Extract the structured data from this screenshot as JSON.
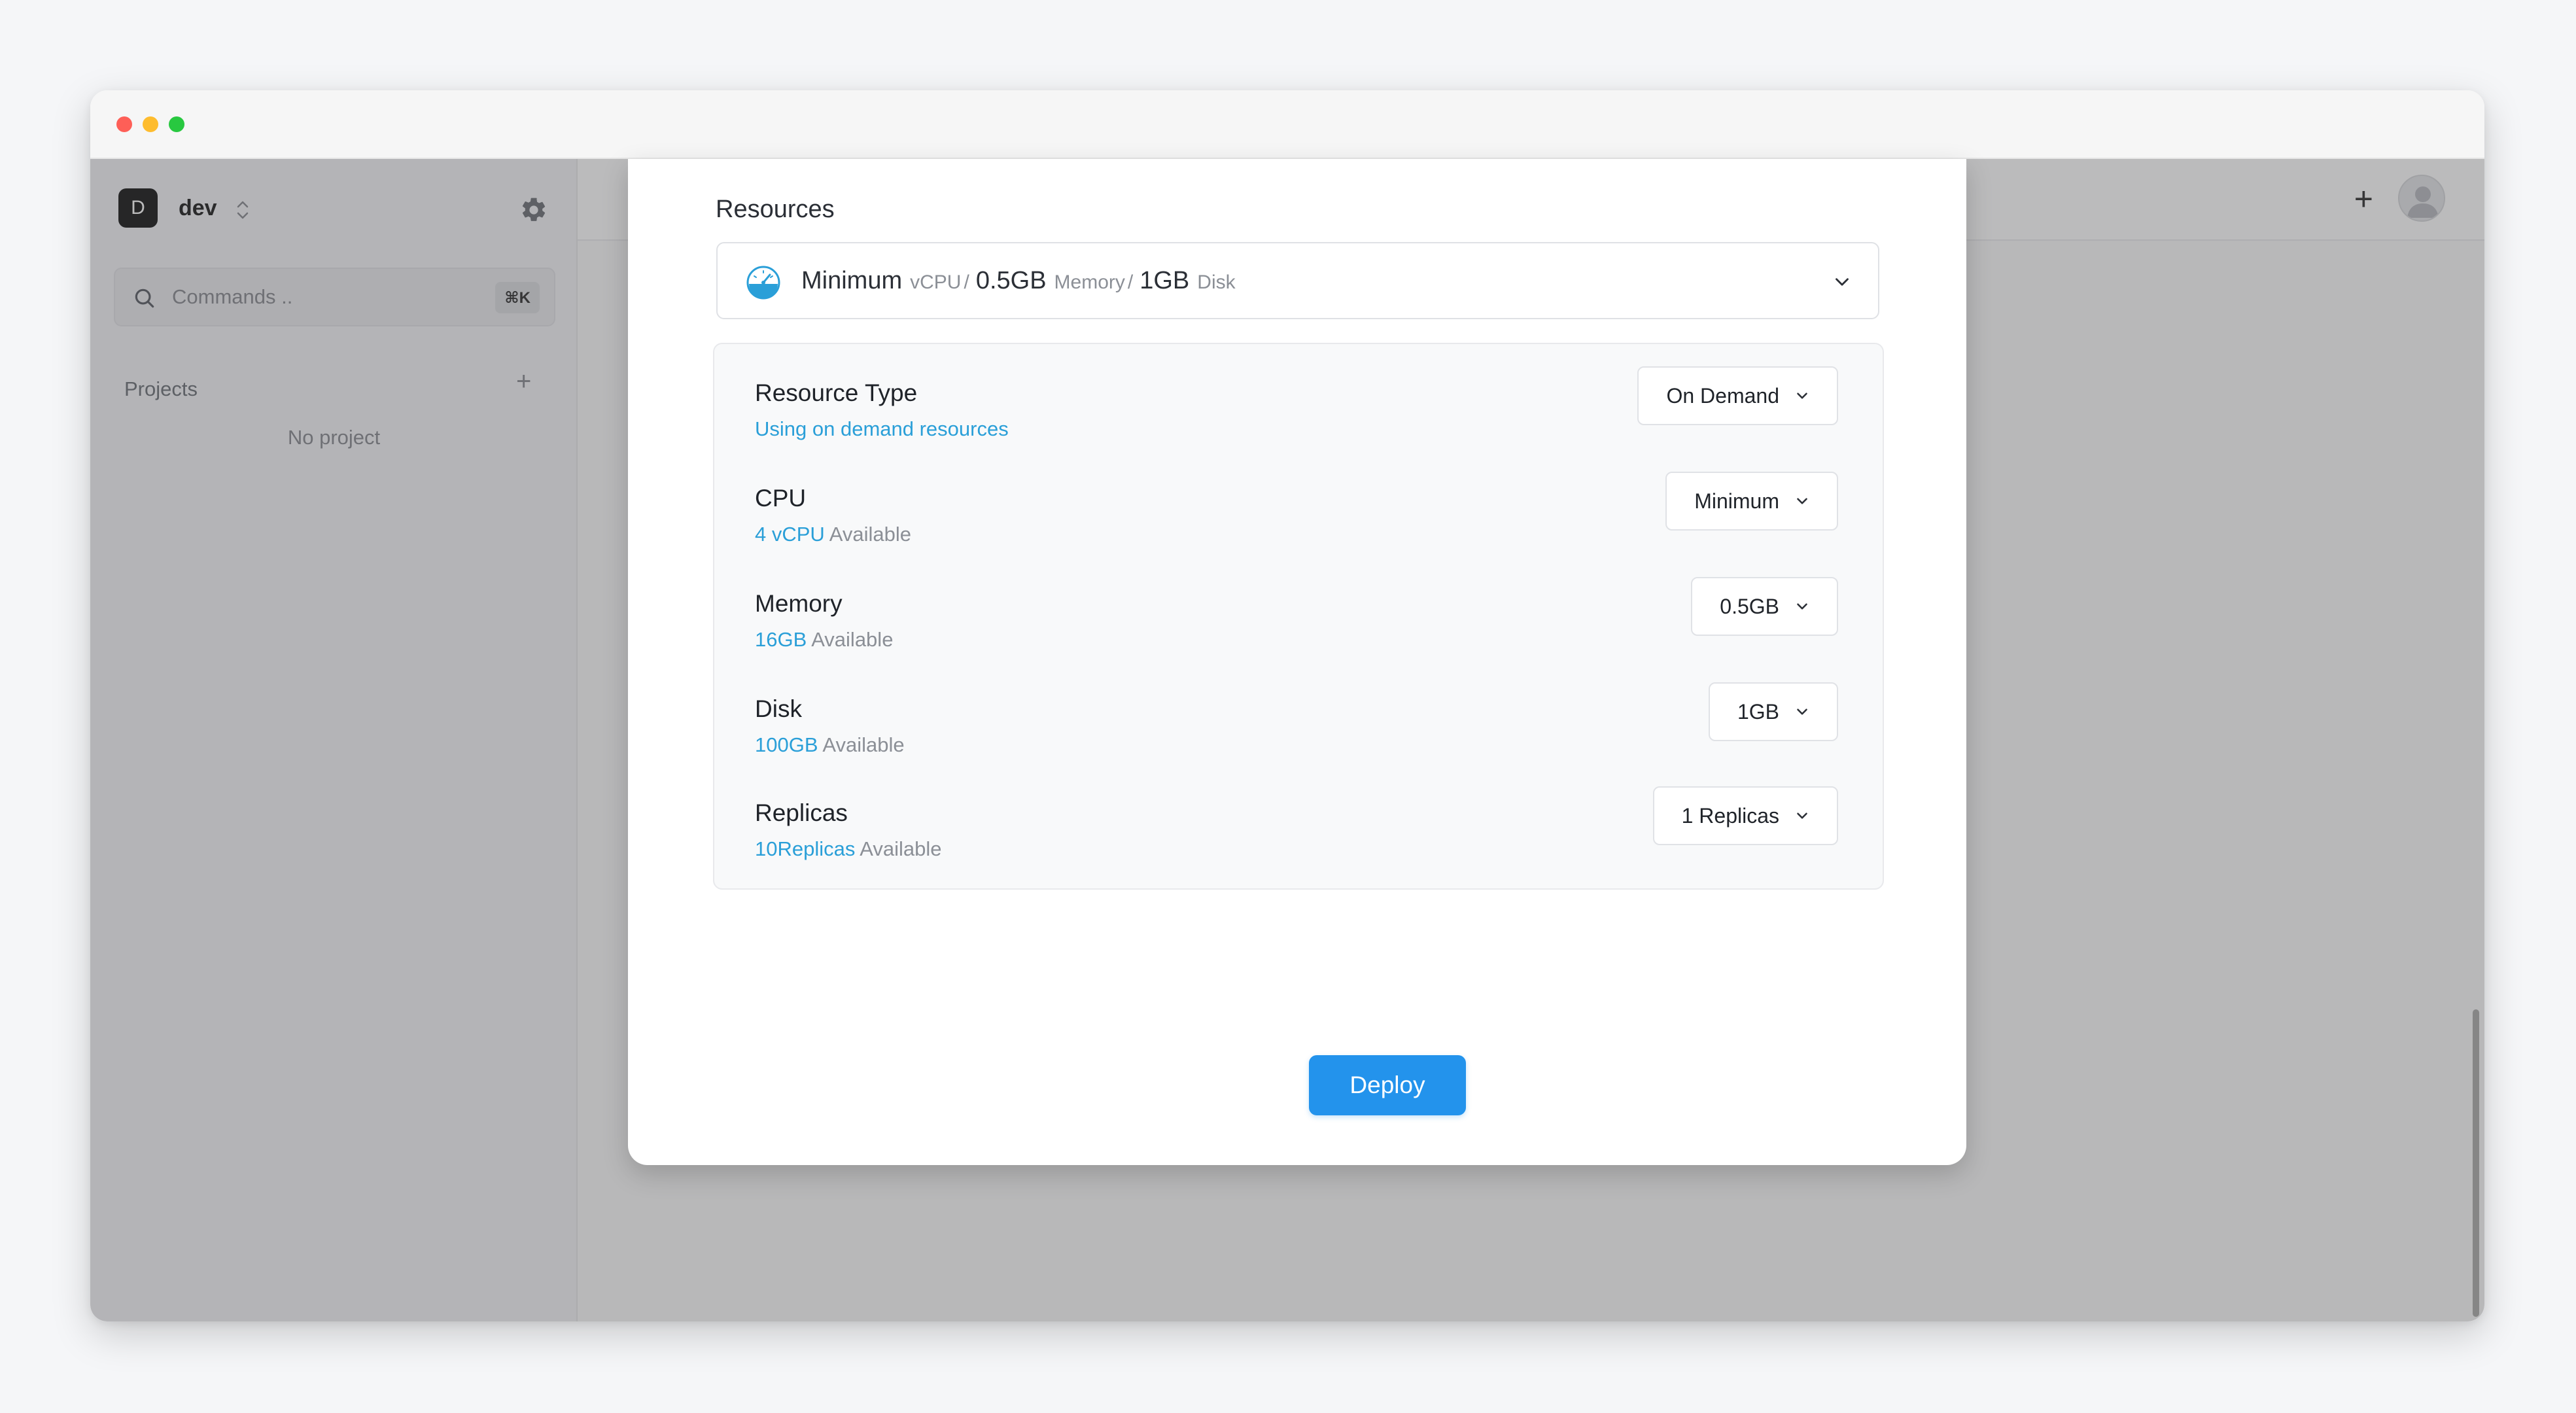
{
  "sidebar": {
    "workspace_initial": "D",
    "workspace_name": "dev",
    "search_placeholder": "Commands ..",
    "search_shortcut": "⌘K",
    "projects_title": "Projects",
    "projects_add": "+",
    "empty_text": "No project"
  },
  "topbar": {
    "add_label": "+"
  },
  "modal": {
    "resources_label": "Resources",
    "summary": {
      "profile": "Minimum",
      "cpu_unit": "vCPU",
      "sep": "/",
      "memory_value": "0.5GB",
      "memory_unit": "Memory",
      "disk_value": "1GB",
      "disk_unit": "Disk"
    },
    "rows": [
      {
        "title": "Resource Type",
        "sub_text": "Using on demand resources",
        "value": "On Demand"
      },
      {
        "title": "CPU",
        "sub_highlight": "4 vCPU",
        "sub_text": "Available",
        "value": "Minimum"
      },
      {
        "title": "Memory",
        "sub_highlight": "16GB",
        "sub_text": "Available",
        "value": "0.5GB"
      },
      {
        "title": "Disk",
        "sub_highlight": "100GB",
        "sub_text": "Available",
        "value": "1GB"
      },
      {
        "title": "Replicas",
        "sub_highlight": "10Replicas",
        "sub_text": "Available",
        "value": "1 Replicas"
      }
    ],
    "deploy_label": "Deploy"
  },
  "colors": {
    "accent": "#2393ec",
    "link": "#2a9fd8"
  }
}
